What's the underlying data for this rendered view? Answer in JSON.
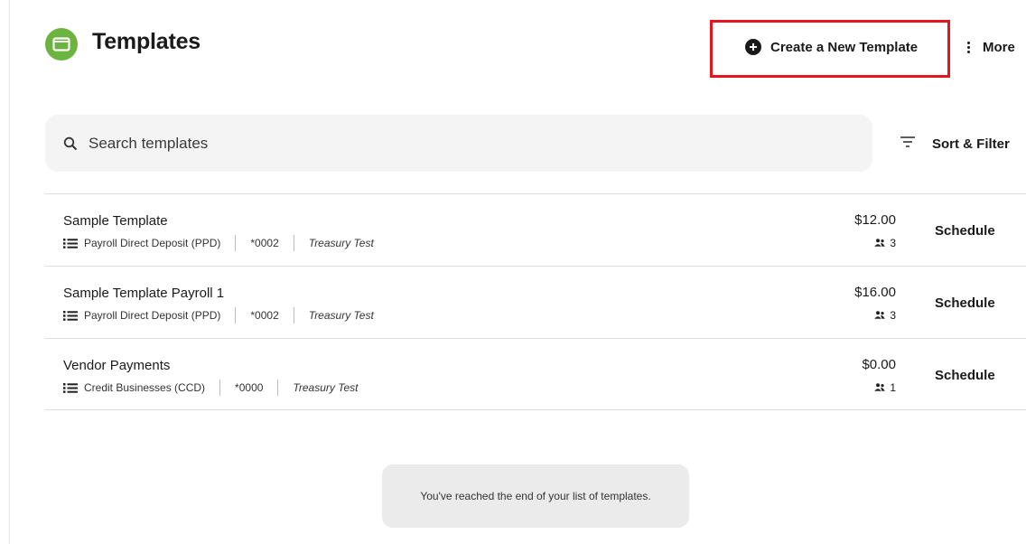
{
  "header": {
    "title": "Templates",
    "create_label": "Create a New Template",
    "more_label": "More"
  },
  "search": {
    "placeholder": "Search templates",
    "value": ""
  },
  "sort_filter_label": "Sort & Filter",
  "templates": [
    {
      "name": "Sample Template",
      "type": "Payroll Direct Deposit (PPD)",
      "account": "*0002",
      "company": "Treasury Test",
      "amount": "$12.00",
      "recipients": "3",
      "action": "Schedule"
    },
    {
      "name": "Sample Template Payroll 1",
      "type": "Payroll Direct Deposit (PPD)",
      "account": "*0002",
      "company": "Treasury Test",
      "amount": "$16.00",
      "recipients": "3",
      "action": "Schedule"
    },
    {
      "name": "Vendor Payments",
      "type": "Credit Businesses (CCD)",
      "account": "*0000",
      "company": "Treasury Test",
      "amount": "$0.00",
      "recipients": "1",
      "action": "Schedule"
    }
  ],
  "end_message": "You've reached the end of your list of templates.",
  "colors": {
    "brand_green": "#6db33f",
    "highlight_red": "#e3161e",
    "search_bg": "#f4f4f4"
  },
  "icons": {
    "app": "folder-icon",
    "create": "plus-circle-icon",
    "more": "kebab-menu-icon",
    "search": "search-icon",
    "sort": "filter-lines-icon",
    "type": "list-icon",
    "recipients": "people-icon"
  }
}
